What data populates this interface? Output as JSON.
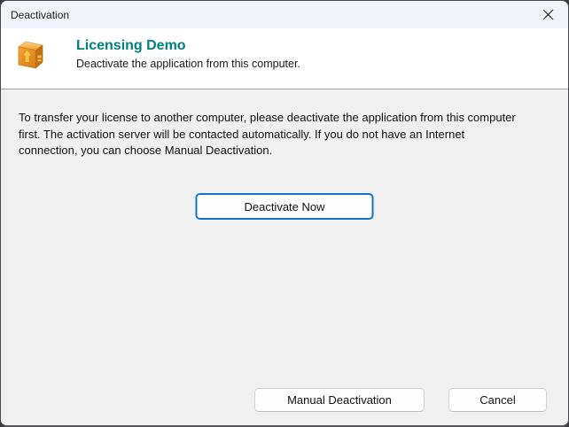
{
  "titlebar": {
    "title": "Deactivation",
    "close_icon": "close-icon"
  },
  "header": {
    "icon": "package-box-icon",
    "title": "Licensing Demo",
    "subtitle": "Deactivate the application from this computer."
  },
  "body": {
    "paragraph": "To transfer your license to another computer, please deactivate the application from this computer first. The activation server will be contacted automatically. If you do not have an Internet connection, you can choose Manual Deactivation."
  },
  "buttons": {
    "primary": {
      "label": "Deactivate Now"
    },
    "footer": [
      {
        "label": "Manual Deactivation"
      },
      {
        "label": "Cancel"
      }
    ]
  },
  "colors": {
    "titlebar_bg": "#F1F3FA",
    "header_bg": "#FFFFFF",
    "body_bg": "#F0F0F0",
    "header_title_teal": "#00807F",
    "primary_button_border_blue": "#1473C5",
    "separator_gray": "#9E9EA0",
    "button_border_gray": "#D2D2D2",
    "icon_orange": "#E08214",
    "icon_arrow_yellow": "#F6C445"
  }
}
